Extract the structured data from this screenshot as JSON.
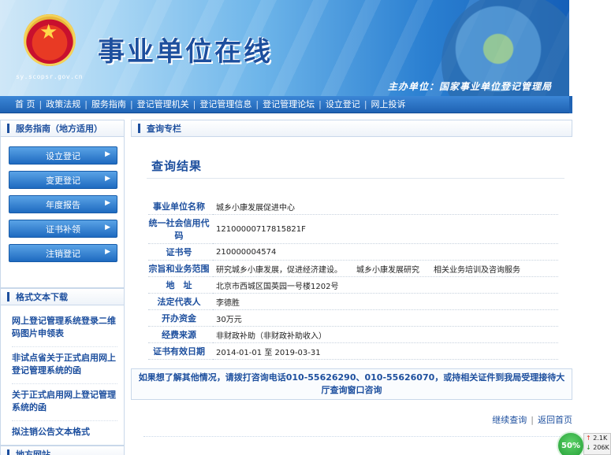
{
  "header": {
    "site_title": "事业单位在线",
    "site_url": "sy.scopsr.gov.cn",
    "sponsor": "主办单位：国家事业单位登记管理局"
  },
  "nav": {
    "items": [
      "首 页",
      "政策法规",
      "服务指南",
      "登记管理机关",
      "登记管理信息",
      "登记管理论坛",
      "设立登记",
      "网上投诉"
    ]
  },
  "sidebar": {
    "guide_title": "服务指南（地方适用）",
    "guide_buttons": [
      "设立登记",
      "变更登记",
      "年度报告",
      "证书补领",
      "注销登记"
    ],
    "doc_title": "格式文本下载",
    "doc_items": [
      "网上登记管理系统登录二维码图片申领表",
      "非试点省关于正式启用网上登记管理系统的函",
      "关于正式启用网上登记管理系统的函",
      "拟注销公告文本格式"
    ],
    "local_title": "地方网站"
  },
  "main": {
    "section_title": "查询专栏",
    "result_title": "查询结果",
    "fields": [
      {
        "label": "事业单位名称",
        "value": "城乡小康发展促进中心"
      },
      {
        "label": "统一社会信用代码",
        "value": "12100000717815821F"
      },
      {
        "label": "证书号",
        "value": "210000004574"
      },
      {
        "label": "宗旨和业务范围",
        "value_parts": [
          "研究城乡小康发展，促进经济建设。",
          "城乡小康发展研究",
          "相关业务培训及咨询服务"
        ]
      },
      {
        "label": "地　址",
        "value": "北京市西城区国英园一号楼1202号"
      },
      {
        "label": "法定代表人",
        "value": "李德胜"
      },
      {
        "label": "开办资金",
        "value": "30万元"
      },
      {
        "label": "经费来源",
        "value": "非财政补助（非财政补助收入）"
      },
      {
        "label": "证书有效日期",
        "value_from": "2014-01-01",
        "value_sep": "至",
        "value_to": "2019-03-31"
      }
    ],
    "notice": "如果想了解其他情况，请拨打咨询电话010-55626290、010-55626070，或持相关证件到我局受理接待大厅查询窗口咨询",
    "links": {
      "continue": "继续查询",
      "home": "返回首页"
    }
  },
  "widget": {
    "percent": "50%",
    "up": "2.1K",
    "down": "206K"
  },
  "colors": {
    "accent": "#1d4f9e",
    "nav": "#1f63b4",
    "button": "#1e6ac0"
  }
}
